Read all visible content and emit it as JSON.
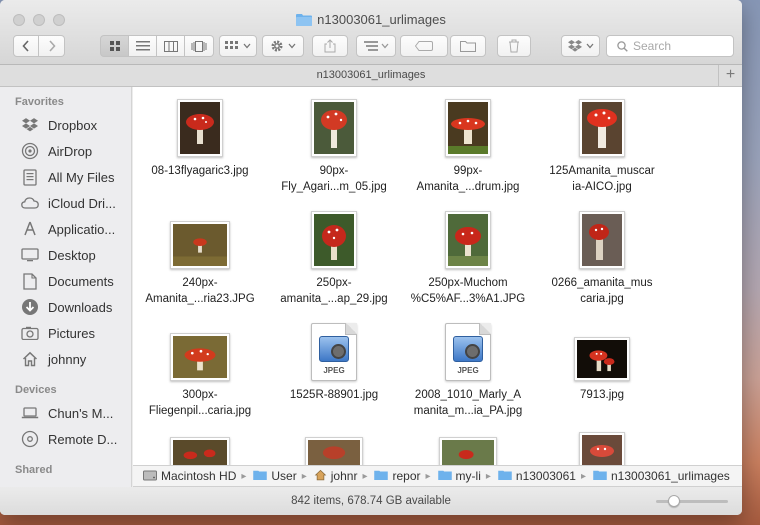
{
  "window": {
    "title": "n13003061_urlimages"
  },
  "toolbar": {
    "search_placeholder": "Search"
  },
  "tabbar": {
    "tab_label": "n13003061_urlimages",
    "add_tab": "+"
  },
  "sidebar": {
    "favorites_header": "Favorites",
    "favorites": [
      {
        "label": "Dropbox",
        "icon": "dropbox-icon"
      },
      {
        "label": "AirDrop",
        "icon": "airdrop-icon"
      },
      {
        "label": "All My Files",
        "icon": "all-files-icon"
      },
      {
        "label": "iCloud Dri...",
        "icon": "icloud-icon"
      },
      {
        "label": "Applicatio...",
        "icon": "applications-icon"
      },
      {
        "label": "Desktop",
        "icon": "desktop-icon"
      },
      {
        "label": "Documents",
        "icon": "documents-icon"
      },
      {
        "label": "Downloads",
        "icon": "downloads-icon"
      },
      {
        "label": "Pictures",
        "icon": "pictures-icon"
      },
      {
        "label": "johnny",
        "icon": "home-icon"
      }
    ],
    "devices_header": "Devices",
    "devices": [
      {
        "label": "Chun's M...",
        "icon": "computer-icon"
      },
      {
        "label": "Remote D...",
        "icon": "disc-icon"
      }
    ],
    "shared_header": "Shared"
  },
  "files": [
    {
      "line1": "08-13flyagaric3.jpg",
      "line2": "",
      "type": "photo"
    },
    {
      "line1": "90px-",
      "line2": "Fly_Agari...m_05.jpg",
      "type": "photo"
    },
    {
      "line1": "99px-",
      "line2": "Amanita_...drum.jpg",
      "type": "photo"
    },
    {
      "line1": "125Amanita_muscar",
      "line2": "ia-AICO.jpg",
      "type": "photo"
    },
    {
      "line1": "240px-",
      "line2": "Amanita_...ria23.JPG",
      "type": "photo"
    },
    {
      "line1": "250px-",
      "line2": "amanita_...ap_29.jpg",
      "type": "photo"
    },
    {
      "line1": "250px-Muchom",
      "line2": "%C5%AF...3%A1.JPG",
      "type": "photo"
    },
    {
      "line1": "0266_amanita_mus",
      "line2": "caria.jpg",
      "type": "photo"
    },
    {
      "line1": "300px-",
      "line2": "Fliegenpil...caria.jpg",
      "type": "photo"
    },
    {
      "line1": "1525R-88901.jpg",
      "line2": "",
      "type": "jpeg",
      "doc_label": "JPEG"
    },
    {
      "line1": "2008_1010_Marly_A",
      "line2": "manita_m...ia_PA.jpg",
      "type": "jpeg",
      "doc_label": "JPEG"
    },
    {
      "line1": "7913.jpg",
      "line2": "",
      "type": "photo"
    }
  ],
  "pathbar": {
    "crumbs": [
      "Macintosh HD",
      "User",
      "johnr",
      "repor",
      "my-li",
      "n13003061",
      "n13003061_urlimages"
    ]
  },
  "status": {
    "text": "842 items, 678.74 GB available",
    "icon_size_level": 0.25
  },
  "colors": {
    "folder_blue": "#5fa8e8",
    "mushroom_red": "#c92a1c",
    "accent": "#3b86e0"
  }
}
